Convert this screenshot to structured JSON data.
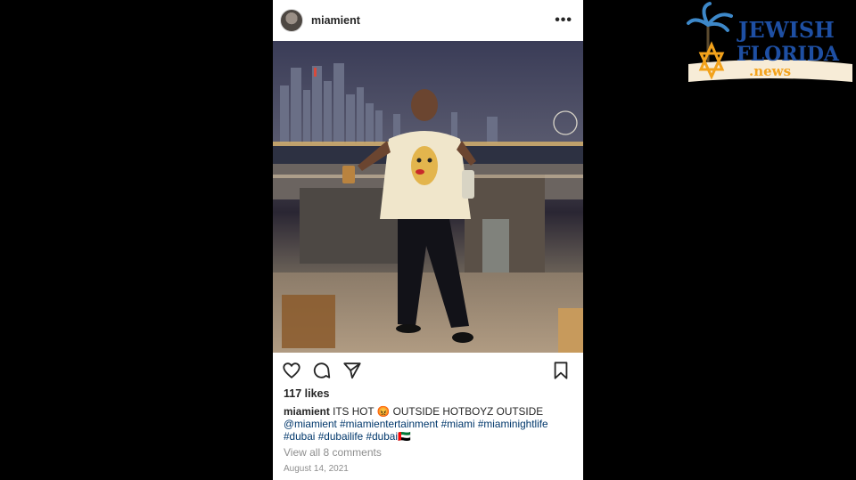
{
  "post": {
    "username": "miamient",
    "more_icon": "more-options-icon",
    "likes": "117 likes",
    "caption": {
      "username": "miamient",
      "text": "ITS HOT 😡 OUTSIDE HOTBOYZ OUTSIDE",
      "mentions": [
        "@miamient",
        "#miamientertainment",
        "#miami",
        "#miaminightlife",
        "#dubai",
        "#dubailife",
        "#dubai🇦🇪"
      ]
    },
    "comments_link": "View all 8 comments",
    "date": "August 14, 2021"
  },
  "logo": {
    "line1": "JEWISH",
    "line2": "FLORIDA",
    "line3": ".news"
  },
  "colors": {
    "link": "#00376b",
    "muted": "#8e8e8e",
    "logo_blue": "#1e4fa3",
    "logo_orange": "#f3a21b"
  }
}
